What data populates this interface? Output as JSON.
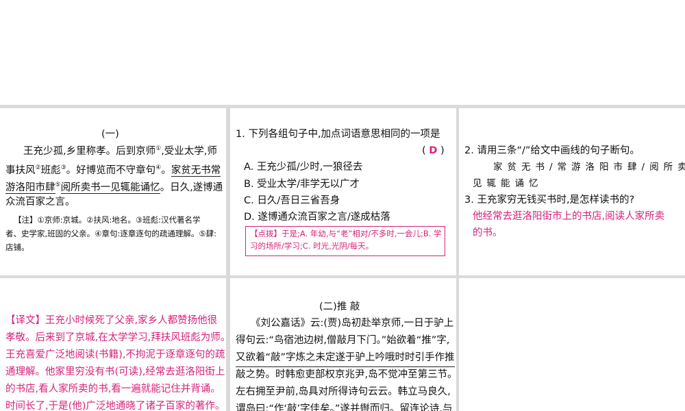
{
  "panel1": {
    "heading": "(一)",
    "line1": "王充少孤,乡里称孝。后到京师",
    "note1": "①",
    "line1b": ",受业太学,师",
    "line2a": "事扶风",
    "note2": "②",
    "line2b": "班彪",
    "note3": "③",
    "line2c": "。好博览而不守章句",
    "note4": "④",
    "line2d": "。",
    "line2u": "家贫无书常",
    "line3a": "游洛阳市肆",
    "note5": "⑤",
    "line3b": "阅所卖书一见辄能诵忆",
    "line3c": "。日久,遂博通",
    "line4": "众流百家之言。",
    "notes_line1": "【注】①京师:京城。②扶风:地名。③班彪:汉代著名学",
    "notes_line2": "者、史学家,班固的父亲。④章句:逐章逐句的疏通理解。⑤肆:",
    "notes_line3": "店铺。"
  },
  "panel2": {
    "q1": "1. 下列各组句子中,加点词语意思相同的一项是",
    "answer_open": "(",
    "answer": "D",
    "answer_close": ")",
    "options": [
      "A. 王充少孤/少时,一狼径去",
      "B. 受业太学/非学无以广才",
      "C. 日久/吾日三省吾身",
      "D. 遂博通众流百家之言/遂成枯落"
    ],
    "hint_line1": "【点拨】于是;A. 年幼,与“老”相对/不多时,一会儿;B. 学",
    "hint_line2": "习的场所/学习;C. 时光,光阴/每天。"
  },
  "panel3": {
    "q2": "2. 请用三条“/”给文中画线的句子断句。",
    "q2_answer_line1": "家贫无书/常游洛阳市肆/阅所卖书/一",
    "q2_answer_line2": "见辄能诵忆",
    "q3": "3. 王充家穷无钱买书时,是怎样读书的?",
    "q3_answer_line1": "他经常去逛洛阳街市上的书店,阅读人家所卖",
    "q3_answer_line2": "的书。"
  },
  "panel4": {
    "lines": [
      "【译文】王充小时候死了父亲,家乡人都赞扬他很",
      "孝敬。后来到了京城,在太学学习,拜扶风班彪为师。",
      "王充喜爱广泛地阅读(书籍),不拘泥于逐章逐句的疏",
      "通理解。他家里穷没有书(可读),经常去逛洛阳街上",
      "的书店,看人家所卖的书,看一遍就能记住并背诵。",
      "时间长了,于是(他)广泛地通晓了诸子百家的著作。"
    ]
  },
  "panel5": {
    "heading": "(二)推  敲",
    "lines": [
      "《刘公嘉话》云:(贾)岛初赴举京师,一日于驴上",
      "得句云:“鸟宿池边树,僧敲月下门。”始欲着“推”字,",
      "又欲着“敲”字炼之未定遂于驴上吟哦时时引手作推",
      "敲之势。时韩愈吏部权京兆尹,岛不觉冲至第三节。",
      "左右拥至尹前,岛具对所得诗句云云。韩立马良久,",
      "谓岛曰:“作‘敲’字佳矣。”遂并辔而归。留连论诗,与"
    ]
  }
}
